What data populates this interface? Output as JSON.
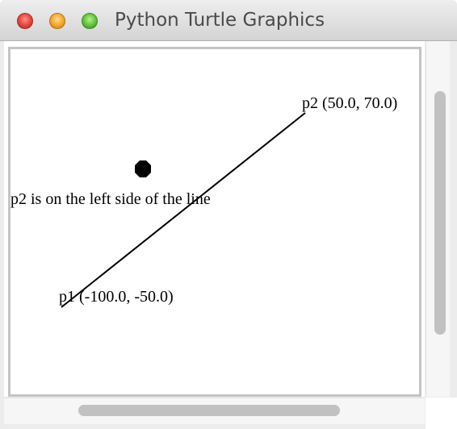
{
  "window": {
    "title": "Python Turtle Graphics"
  },
  "canvas": {
    "labels": {
      "p1": "p1 (-100.0, -50.0)",
      "p2": "p2 (50.0, 70.0)",
      "message": "p2 is on the left side of the line"
    },
    "line_color": "#000000",
    "dot_color": "#000000"
  },
  "colors": {
    "close": "#e0443a",
    "minimize": "#f2a52a",
    "maximize": "#5cc23a"
  }
}
